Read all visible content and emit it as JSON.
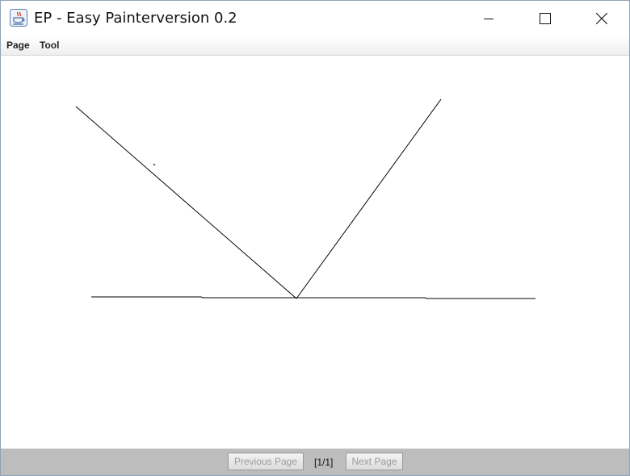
{
  "window": {
    "title": "EP - Easy Painterversion 0.2",
    "app_icon": "java-cup-icon",
    "controls": [
      "minimize-icon",
      "maximize-icon",
      "close-icon"
    ]
  },
  "menubar": {
    "items": [
      {
        "label": "Page"
      },
      {
        "label": "Tool"
      }
    ]
  },
  "canvas": {
    "background": "#ffffff",
    "stroke_color": "#000000"
  },
  "pagination": {
    "previous_label": "Previous Page",
    "page_indicator": "[1/1]",
    "next_label": "Next Page",
    "bar_color": "#bdbdbd"
  }
}
